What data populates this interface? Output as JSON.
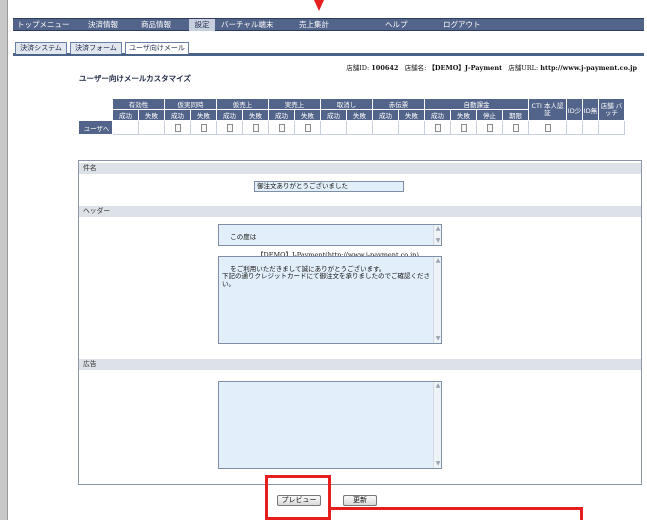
{
  "navbar": {
    "items": [
      "トップメニュー",
      "決済情報",
      "商品情報",
      "設定",
      "バーチャル端末",
      "売上集計",
      "ヘルプ",
      "ログアウト"
    ],
    "active": "設定"
  },
  "tabs": [
    "決済システム",
    "決済フォーム",
    "ユーザ向けメール"
  ],
  "store_info": {
    "id_label": "店舗ID:",
    "id_value": "100642",
    "name_label": "店舗名:",
    "name_value": "【DEMO】J-Payment",
    "url_label": "店舗URL:",
    "url_value": "http://www.j-payment.co.jp"
  },
  "page_title": "ユーザー向けメールカスタマイズ",
  "settings_table": {
    "groups": [
      "有効性",
      "仮実同時",
      "仮売上",
      "実売上",
      "取消し",
      "赤伝票",
      "自動課金",
      "CTI 本人認証",
      "ID少",
      "ID無",
      "店舗 バッチ"
    ],
    "subheaders": [
      "成功",
      "失敗",
      "成功",
      "失敗",
      "成功",
      "失敗",
      "成功",
      "失敗",
      "成功",
      "失敗",
      "成功",
      "失敗",
      "成功",
      "失敗",
      "停止",
      "期限"
    ],
    "row_label": "ユーザへ"
  },
  "form": {
    "subject_heading": "件名",
    "subject_value": "御注文ありがとうございました",
    "header_heading": "ヘッダー",
    "header_greeting": "この度は",
    "company_line": "【DEMO】J-Payment(http://www.j-payment.co.jp)",
    "header_body": "をご利用いただきまして誠にありがとうございます。\n下記の通りクレジットカードにて御注文を承りましたのでご確認ください。",
    "ad_heading": "広告",
    "ad_value": ""
  },
  "buttons": {
    "preview": "プレビュー",
    "update": "更新"
  },
  "colors": {
    "nav": "#53648a",
    "highlight": "#e61e1e",
    "textarea_bg": "#e2eefa"
  }
}
